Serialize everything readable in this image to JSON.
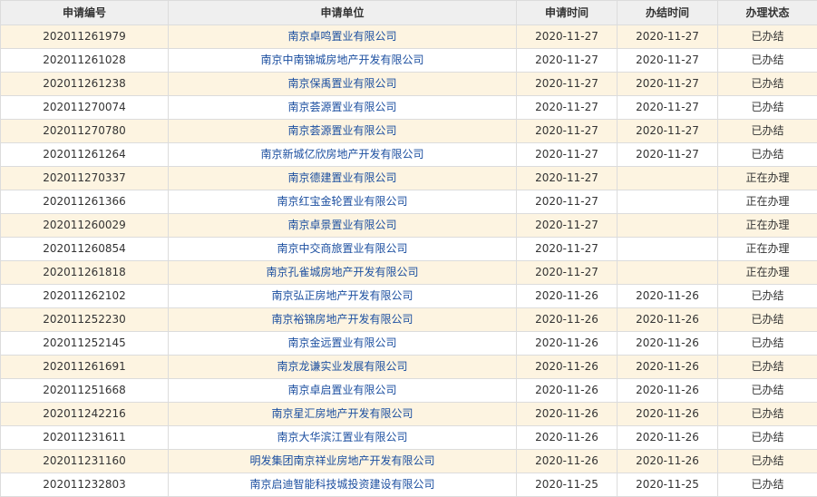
{
  "table": {
    "headers": [
      "申请编号",
      "申请单位",
      "申请时间",
      "办结时间",
      "办理状态"
    ],
    "rows": [
      [
        "202011261979",
        "南京卓鸣置业有限公司",
        "2020-11-27",
        "2020-11-27",
        "已办结"
      ],
      [
        "202011261028",
        "南京中南锦城房地产开发有限公司",
        "2020-11-27",
        "2020-11-27",
        "已办结"
      ],
      [
        "202011261238",
        "南京保禹置业有限公司",
        "2020-11-27",
        "2020-11-27",
        "已办结"
      ],
      [
        "202011270074",
        "南京荟源置业有限公司",
        "2020-11-27",
        "2020-11-27",
        "已办结"
      ],
      [
        "202011270780",
        "南京荟源置业有限公司",
        "2020-11-27",
        "2020-11-27",
        "已办结"
      ],
      [
        "202011261264",
        "南京新城亿欣房地产开发有限公司",
        "2020-11-27",
        "2020-11-27",
        "已办结"
      ],
      [
        "202011270337",
        "南京德建置业有限公司",
        "2020-11-27",
        "",
        "正在办理"
      ],
      [
        "202011261366",
        "南京红宝金轮置业有限公司",
        "2020-11-27",
        "",
        "正在办理"
      ],
      [
        "202011260029",
        "南京卓景置业有限公司",
        "2020-11-27",
        "",
        "正在办理"
      ],
      [
        "202011260854",
        "南京中交商旅置业有限公司",
        "2020-11-27",
        "",
        "正在办理"
      ],
      [
        "202011261818",
        "南京孔雀城房地产开发有限公司",
        "2020-11-27",
        "",
        "正在办理"
      ],
      [
        "202011262102",
        "南京弘正房地产开发有限公司",
        "2020-11-26",
        "2020-11-26",
        "已办结"
      ],
      [
        "202011252230",
        "南京裕锦房地产开发有限公司",
        "2020-11-26",
        "2020-11-26",
        "已办结"
      ],
      [
        "202011252145",
        "南京金远置业有限公司",
        "2020-11-26",
        "2020-11-26",
        "已办结"
      ],
      [
        "202011261691",
        "南京龙谦实业发展有限公司",
        "2020-11-26",
        "2020-11-26",
        "已办结"
      ],
      [
        "202011251668",
        "南京卓启置业有限公司",
        "2020-11-26",
        "2020-11-26",
        "已办结"
      ],
      [
        "202011242216",
        "南京星汇房地产开发有限公司",
        "2020-11-26",
        "2020-11-26",
        "已办结"
      ],
      [
        "202011231611",
        "南京大华滨江置业有限公司",
        "2020-11-26",
        "2020-11-26",
        "已办结"
      ],
      [
        "202011231160",
        "明发集团南京祥业房地产开发有限公司",
        "2020-11-26",
        "2020-11-26",
        "已办结"
      ],
      [
        "202011232803",
        "南京启迪智能科技城投资建设有限公司",
        "2020-11-25",
        "2020-11-25",
        "已办结"
      ]
    ]
  }
}
